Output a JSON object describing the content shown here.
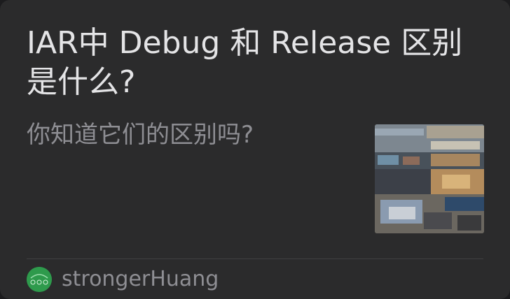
{
  "article": {
    "title": "IAR中 Debug 和 Release 区别是什么?",
    "subtitle": "你知道它们的区别吗?",
    "thumbnail_icon": "photo-thumbnail",
    "source": {
      "name": "strongerHuang",
      "avatar_icon": "account-avatar",
      "avatar_color": "#2e9a4c"
    }
  },
  "colors": {
    "card_background": "#2b2b2c",
    "title_text": "#e4e4e6",
    "secondary_text": "#8e8e93"
  }
}
